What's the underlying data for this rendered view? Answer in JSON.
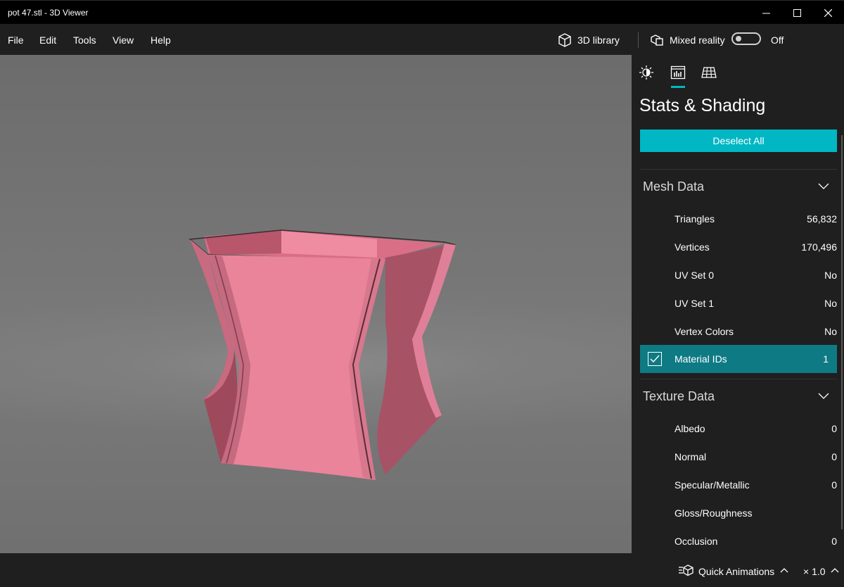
{
  "window": {
    "title": "pot 47.stl - 3D Viewer",
    "controls": [
      "minimize",
      "maximize",
      "close"
    ]
  },
  "menu": {
    "items": [
      "File",
      "Edit",
      "Tools",
      "View",
      "Help"
    ]
  },
  "toolbar": {
    "library_label": "3D library",
    "library_icon": "cube-icon",
    "mixed_reality_label": "Mixed reality",
    "mixed_reality_icon": "mixed-reality-icon",
    "mixed_reality_state": "Off",
    "mixed_reality_on": false
  },
  "viewport": {
    "model_color": "#e8849a",
    "background_color": "#767676"
  },
  "panel": {
    "tabs": [
      "lighting-icon",
      "stats-icon",
      "grid-icon"
    ],
    "active_tab": 1,
    "title": "Stats & Shading",
    "deselect_label": "Deselect All",
    "accent_color": "#00b7c3",
    "sections": [
      {
        "header": "Mesh Data",
        "expanded": true,
        "rows": [
          {
            "label": "Triangles",
            "value": "56,832",
            "selected": false
          },
          {
            "label": "Vertices",
            "value": "170,496",
            "selected": false
          },
          {
            "label": "UV Set 0",
            "value": "No",
            "selected": false
          },
          {
            "label": "UV Set 1",
            "value": "No",
            "selected": false
          },
          {
            "label": "Vertex Colors",
            "value": "No",
            "selected": false
          },
          {
            "label": "Material IDs",
            "value": "1",
            "selected": true
          }
        ]
      },
      {
        "header": "Texture Data",
        "expanded": true,
        "rows": [
          {
            "label": "Albedo",
            "value": "0",
            "selected": false
          },
          {
            "label": "Normal",
            "value": "0",
            "selected": false
          },
          {
            "label": "Specular/Metallic",
            "value": "0",
            "selected": false
          },
          {
            "label": "Gloss/Roughness",
            "value": "",
            "selected": false
          },
          {
            "label": "Occlusion",
            "value": "0",
            "selected": false
          }
        ]
      }
    ]
  },
  "statusbar": {
    "animations_label": "Quick Animations",
    "speed_label": "× 1.0"
  }
}
